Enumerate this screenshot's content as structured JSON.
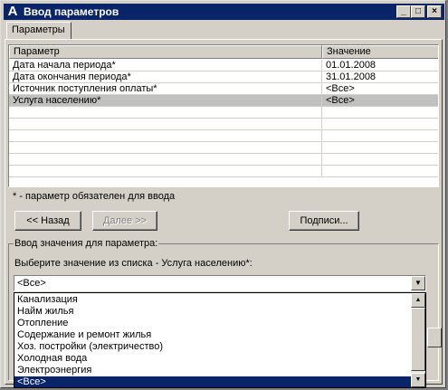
{
  "window": {
    "title": "Ввод параметров"
  },
  "tab": {
    "label": "Параметры"
  },
  "grid": {
    "headers": {
      "param": "Параметр",
      "value": "Значение"
    },
    "rows": [
      {
        "param": "Дата начала периода*",
        "value": "01.01.2008"
      },
      {
        "param": "Дата окончания периода*",
        "value": "31.01.2008"
      },
      {
        "param": "Источник поступления оплаты*",
        "value": "<Все>"
      },
      {
        "param": "Услуга населению*",
        "value": "<Все>"
      }
    ]
  },
  "note": "* - параметр обязателен для ввода",
  "buttons": {
    "back": "<< Назад",
    "next": "Далее >>",
    "signatures": "Подписи..."
  },
  "group": {
    "label": "Ввод значения для параметра:",
    "prompt": "Выберите значение из списка - Услуга населению*:"
  },
  "combo": {
    "value": "<Все>"
  },
  "list": {
    "items": [
      "Канализация",
      "Найм жилья",
      "Отопление",
      "Содержание и ремонт жилья",
      "Хоз. постройки (электричество)",
      "Холодная вода",
      "Электроэнергия",
      "<Все>"
    ],
    "selected_index": 7
  }
}
